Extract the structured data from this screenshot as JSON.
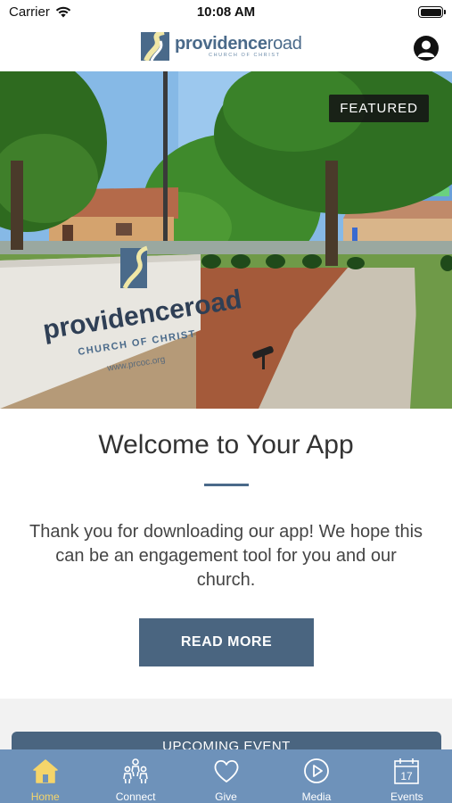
{
  "status_bar": {
    "carrier": "Carrier",
    "time": "10:08 AM"
  },
  "header": {
    "logo_word_bold": "providence",
    "logo_word_light": "road",
    "logo_subtitle": "CHURCH OF CHRIST"
  },
  "hero": {
    "badge": "FEATURED",
    "sign_word": "providenceroad",
    "sign_subtitle": "CHURCH OF CHRIST",
    "sign_url": "www.prcoc.org"
  },
  "welcome": {
    "title": "Welcome to Your App",
    "body": "Thank you for downloading our app! We hope this can be an engagement tool for you and our church.",
    "button": "READ MORE"
  },
  "upcoming": {
    "label": "UPCOMING EVENT"
  },
  "tabs": [
    {
      "label": "Home",
      "icon": "home-icon",
      "active": true
    },
    {
      "label": "Connect",
      "icon": "people-icon",
      "active": false
    },
    {
      "label": "Give",
      "icon": "heart-icon",
      "active": false
    },
    {
      "label": "Media",
      "icon": "play-icon",
      "active": false
    },
    {
      "label": "Events",
      "icon": "calendar-icon",
      "active": false,
      "badge": "17"
    }
  ],
  "colors": {
    "accent": "#4a6580",
    "tab_bar": "#6e92ba",
    "active_tab": "#f5d56a"
  }
}
